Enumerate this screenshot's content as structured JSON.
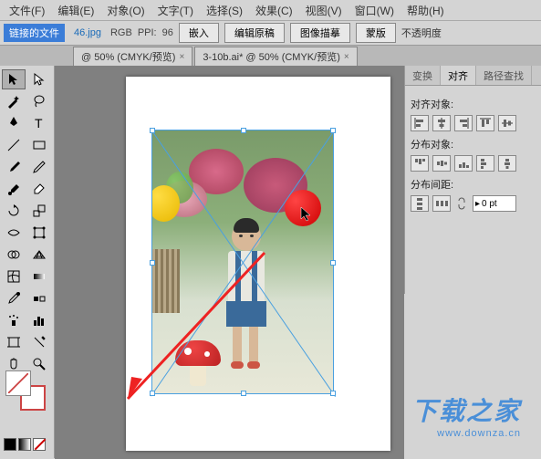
{
  "menu": {
    "file": "文件(F)",
    "edit": "编辑(E)",
    "object": "对象(O)",
    "type": "文字(T)",
    "select": "选择(S)",
    "effect": "效果(C)",
    "view": "视图(V)",
    "window": "窗口(W)",
    "help": "帮助(H)"
  },
  "options": {
    "linked_file": "链接的文件",
    "filename": "46.jpg",
    "colormode": "RGB",
    "ppi_label": "PPI:",
    "ppi_value": "96",
    "embed": "嵌入",
    "edit_original": "编辑原稿",
    "image_trace": "图像描摹",
    "mask": "蒙版",
    "opacity": "不透明度"
  },
  "tabs": {
    "tab1": "@ 50% (CMYK/预览)",
    "tab2": "3-10b.ai* @ 50% (CMYK/预览)"
  },
  "panel": {
    "tab_transform": "变换",
    "tab_align": "对齐",
    "tab_pathfinder": "路径查找",
    "align_objects": "对齐对象:",
    "distribute_objects": "分布对象:",
    "distribute_spacing": "分布间距:",
    "spacing_value": "0 pt"
  },
  "watermark": {
    "main": "下载之家",
    "sub": "www.downza.cn"
  }
}
